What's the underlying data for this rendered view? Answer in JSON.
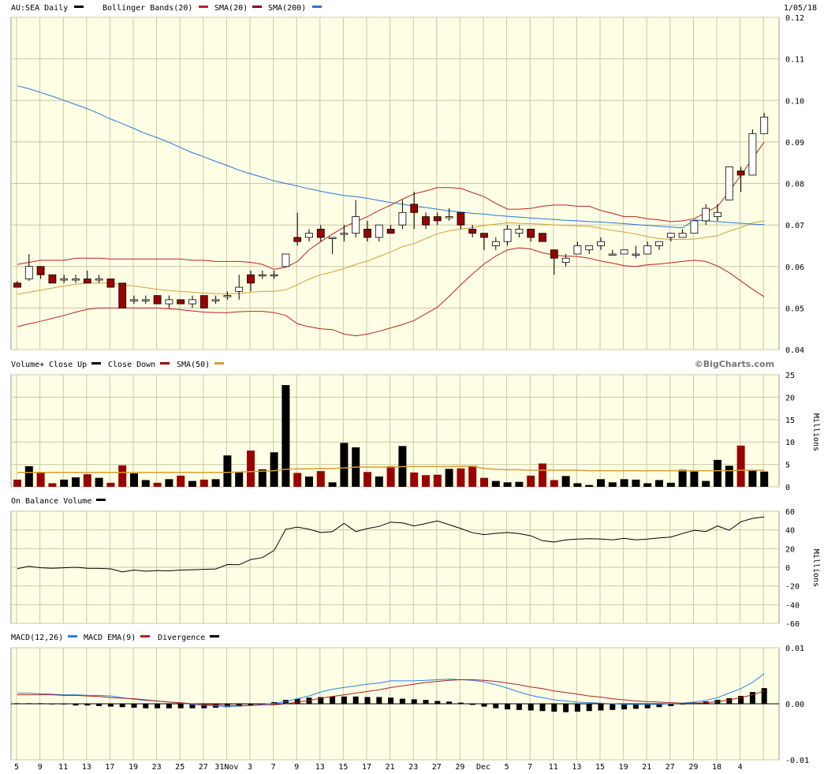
{
  "header": {
    "symbol_title": "AU:SEA Daily",
    "bb_label": "Bollinger Bands(20)",
    "sma20_label": "SMA(20)",
    "sma200_label": "SMA(200)",
    "date": "1/05/18"
  },
  "volume_header": {
    "title": "Volume+",
    "close_up": "Close Up",
    "close_down": "Close Down",
    "sma50": "SMA(50)",
    "credit": "©BigCharts.com",
    "units": "Millions"
  },
  "obv_header": {
    "title": "On Balance Volume",
    "units": "Millions"
  },
  "macd_header": {
    "title": "MACD(12,26)",
    "ema": "MACD EMA(9)",
    "divergence": "Divergence"
  },
  "colors": {
    "panel_bg": "#ffffe6",
    "grid": "#c8c8a0",
    "up": "#000000",
    "down": "#990000",
    "bb": "#bb2222",
    "sma20": "#990000",
    "sma200": "#2a73d8",
    "vol_sma": "#d4a030",
    "macd": "#2a7fe0",
    "macd_ema": "#aa2222"
  },
  "chart_data": [
    {
      "type": "candlestick",
      "title": "AU:SEA Daily",
      "x_tick_labels": [
        "5",
        "9",
        "11",
        "13",
        "17",
        "19",
        "23",
        "25",
        "27",
        "31Nov",
        "3",
        "7",
        "9",
        "13",
        "15",
        "17",
        "21",
        "23",
        "27",
        "29",
        "Dec",
        "5",
        "7",
        "11",
        "13",
        "15",
        "19",
        "21",
        "27",
        "29",
        "18",
        "4"
      ],
      "ylim": [
        0.04,
        0.12
      ],
      "y_ticks": [
        "0.12",
        "0.11",
        "0.10",
        "0.09",
        "0.08",
        "0.07",
        "0.06",
        "0.05",
        "0.04"
      ],
      "ohlc": [
        [
          0.056,
          0.0565,
          0.055,
          0.055
        ],
        [
          0.057,
          0.063,
          0.0565,
          0.06
        ],
        [
          0.06,
          0.06,
          0.057,
          0.058
        ],
        [
          0.058,
          0.058,
          0.056,
          0.056
        ],
        [
          0.057,
          0.058,
          0.056,
          0.057
        ],
        [
          0.057,
          0.058,
          0.056,
          0.057
        ],
        [
          0.057,
          0.059,
          0.056,
          0.056
        ],
        [
          0.057,
          0.058,
          0.056,
          0.057
        ],
        [
          0.057,
          0.057,
          0.055,
          0.055
        ],
        [
          0.056,
          0.056,
          0.05,
          0.05
        ],
        [
          0.052,
          0.053,
          0.051,
          0.052
        ],
        [
          0.052,
          0.053,
          0.051,
          0.052
        ],
        [
          0.053,
          0.053,
          0.051,
          0.051
        ],
        [
          0.051,
          0.053,
          0.05,
          0.052
        ],
        [
          0.052,
          0.052,
          0.051,
          0.051
        ],
        [
          0.051,
          0.053,
          0.05,
          0.052
        ],
        [
          0.053,
          0.053,
          0.05,
          0.05
        ],
        [
          0.052,
          0.053,
          0.051,
          0.052
        ],
        [
          0.053,
          0.054,
          0.052,
          0.053
        ],
        [
          0.054,
          0.058,
          0.052,
          0.055
        ],
        [
          0.058,
          0.059,
          0.054,
          0.056
        ],
        [
          0.058,
          0.059,
          0.057,
          0.058
        ],
        [
          0.058,
          0.059,
          0.057,
          0.058
        ],
        [
          0.06,
          0.063,
          0.06,
          0.063
        ],
        [
          0.067,
          0.073,
          0.065,
          0.066
        ],
        [
          0.067,
          0.069,
          0.066,
          0.068
        ],
        [
          0.069,
          0.07,
          0.066,
          0.067
        ],
        [
          0.067,
          0.067,
          0.063,
          0.067
        ],
        [
          0.068,
          0.07,
          0.066,
          0.068
        ],
        [
          0.068,
          0.076,
          0.067,
          0.072
        ],
        [
          0.069,
          0.071,
          0.066,
          0.067
        ],
        [
          0.067,
          0.07,
          0.066,
          0.07
        ],
        [
          0.069,
          0.07,
          0.068,
          0.068
        ],
        [
          0.07,
          0.076,
          0.069,
          0.073
        ],
        [
          0.075,
          0.078,
          0.069,
          0.073
        ],
        [
          0.072,
          0.073,
          0.069,
          0.07
        ],
        [
          0.072,
          0.073,
          0.07,
          0.071
        ],
        [
          0.072,
          0.074,
          0.071,
          0.072
        ],
        [
          0.073,
          0.073,
          0.069,
          0.07
        ],
        [
          0.069,
          0.07,
          0.067,
          0.068
        ],
        [
          0.068,
          0.068,
          0.064,
          0.067
        ],
        [
          0.065,
          0.067,
          0.064,
          0.066
        ],
        [
          0.066,
          0.07,
          0.065,
          0.069
        ],
        [
          0.068,
          0.07,
          0.067,
          0.069
        ],
        [
          0.069,
          0.069,
          0.066,
          0.067
        ],
        [
          0.068,
          0.068,
          0.066,
          0.066
        ],
        [
          0.064,
          0.064,
          0.058,
          0.062
        ],
        [
          0.061,
          0.063,
          0.06,
          0.062
        ],
        [
          0.063,
          0.066,
          0.063,
          0.065
        ],
        [
          0.064,
          0.065,
          0.063,
          0.065
        ],
        [
          0.065,
          0.067,
          0.064,
          0.066
        ],
        [
          0.063,
          0.064,
          0.063,
          0.063
        ],
        [
          0.063,
          0.064,
          0.063,
          0.064
        ],
        [
          0.063,
          0.065,
          0.062,
          0.063
        ],
        [
          0.063,
          0.066,
          0.063,
          0.065
        ],
        [
          0.065,
          0.066,
          0.064,
          0.066
        ],
        [
          0.067,
          0.068,
          0.066,
          0.068
        ],
        [
          0.067,
          0.069,
          0.067,
          0.068
        ],
        [
          0.068,
          0.071,
          0.068,
          0.071
        ],
        [
          0.071,
          0.075,
          0.07,
          0.074
        ],
        [
          0.072,
          0.075,
          0.071,
          0.073
        ],
        [
          0.076,
          0.084,
          0.076,
          0.084
        ],
        [
          0.083,
          0.084,
          0.078,
          0.082
        ],
        [
          0.082,
          0.093,
          0.082,
          0.092
        ],
        [
          0.092,
          0.097,
          0.092,
          0.096
        ]
      ],
      "bollinger_upper": [
        0.0605,
        0.061,
        0.0615,
        0.0615,
        0.0615,
        0.062,
        0.062,
        0.062,
        0.0618,
        0.0618,
        0.0618,
        0.0618,
        0.0618,
        0.0618,
        0.0618,
        0.0615,
        0.0615,
        0.0612,
        0.0612,
        0.0612,
        0.061,
        0.0605,
        0.0593,
        0.0598,
        0.0612,
        0.064,
        0.066,
        0.0678,
        0.0695,
        0.0708,
        0.072,
        0.0735,
        0.0748,
        0.0762,
        0.0775,
        0.0782,
        0.079,
        0.079,
        0.0788,
        0.0778,
        0.0768,
        0.0752,
        0.0738,
        0.0738,
        0.074,
        0.0745,
        0.0748,
        0.0748,
        0.0745,
        0.0745,
        0.0735,
        0.0728,
        0.072,
        0.072,
        0.0715,
        0.0712,
        0.0708,
        0.071,
        0.0715,
        0.073,
        0.0745,
        0.078,
        0.082,
        0.086,
        0.09
      ],
      "sma20": [
        0.0533,
        0.0538,
        0.0543,
        0.0548,
        0.0553,
        0.0557,
        0.056,
        0.056,
        0.056,
        0.0556,
        0.0553,
        0.0549,
        0.0545,
        0.0542,
        0.054,
        0.0538,
        0.0536,
        0.0535,
        0.0534,
        0.0535,
        0.0538,
        0.054,
        0.054,
        0.0544,
        0.0556,
        0.057,
        0.058,
        0.0587,
        0.0595,
        0.0605,
        0.0613,
        0.0624,
        0.0635,
        0.0648,
        0.0655,
        0.0667,
        0.0679,
        0.0686,
        0.069,
        0.0694,
        0.0699,
        0.0702,
        0.0705,
        0.0704,
        0.0703,
        0.0702,
        0.07,
        0.0699,
        0.0698,
        0.0697,
        0.0692,
        0.0687,
        0.0683,
        0.0678,
        0.0672,
        0.0667,
        0.0665,
        0.0665,
        0.0666,
        0.067,
        0.0674,
        0.0685,
        0.0694,
        0.0705,
        0.071
      ],
      "bollinger_lower": [
        0.0455,
        0.0462,
        0.0468,
        0.0475,
        0.0482,
        0.049,
        0.0497,
        0.05,
        0.05,
        0.05,
        0.05,
        0.05,
        0.05,
        0.0498,
        0.0496,
        0.0493,
        0.049,
        0.0489,
        0.0489,
        0.0491,
        0.0492,
        0.0492,
        0.0489,
        0.0482,
        0.0462,
        0.0455,
        0.045,
        0.0448,
        0.0437,
        0.0433,
        0.0437,
        0.0444,
        0.0452,
        0.046,
        0.047,
        0.0486,
        0.0502,
        0.0528,
        0.0556,
        0.0582,
        0.0606,
        0.0625,
        0.064,
        0.0645,
        0.0642,
        0.0633,
        0.0627,
        0.0625,
        0.0624,
        0.062,
        0.0613,
        0.0608,
        0.0602,
        0.06,
        0.0604,
        0.0606,
        0.0609,
        0.0612,
        0.0615,
        0.0612,
        0.0601,
        0.0585,
        0.0565,
        0.0545,
        0.0527
      ],
      "sma200": [
        0.1035,
        0.1028,
        0.1019,
        0.101,
        0.1,
        0.099,
        0.098,
        0.0968,
        0.0955,
        0.0944,
        0.0932,
        0.092,
        0.091,
        0.0899,
        0.0886,
        0.0874,
        0.0864,
        0.0853,
        0.0843,
        0.0832,
        0.0823,
        0.0815,
        0.0806,
        0.08,
        0.0794,
        0.0787,
        0.0781,
        0.0776,
        0.0771,
        0.0768,
        0.0764,
        0.0759,
        0.0754,
        0.075,
        0.0745,
        0.0742,
        0.0738,
        0.0734,
        0.0731,
        0.0728,
        0.0726,
        0.0723,
        0.0721,
        0.0719,
        0.0717,
        0.0715,
        0.0713,
        0.0711,
        0.071,
        0.0708,
        0.0707,
        0.0705,
        0.0703,
        0.0701,
        0.0699,
        0.0697,
        0.0695,
        0.0693,
        0.0712,
        0.071,
        0.0708,
        0.0706,
        0.0704,
        0.0702,
        0.0701
      ]
    },
    {
      "type": "bar",
      "title": "Volume+",
      "units": "Millions",
      "ylim": [
        0,
        25
      ],
      "y_ticks": [
        "25",
        "20",
        "15",
        "10",
        "5",
        "0"
      ],
      "values": [
        1.6,
        4.6,
        3.1,
        0.8,
        1.6,
        2.1,
        2.8,
        2.0,
        0.9,
        4.8,
        3.0,
        1.5,
        0.9,
        1.7,
        2.5,
        1.3,
        1.6,
        1.7,
        7.0,
        3.3,
        8.1,
        3.9,
        7.7,
        22.7,
        3.1,
        2.3,
        3.5,
        1.0,
        9.8,
        8.8,
        3.3,
        2.3,
        4.6,
        9.1,
        3.2,
        2.6,
        2.7,
        4.0,
        4.1,
        4.7,
        2.0,
        1.3,
        1.0,
        1.1,
        2.5,
        5.2,
        1.5,
        2.4,
        0.8,
        0.4,
        1.7,
        1.0,
        1.7,
        1.6,
        0.8,
        1.5,
        0.9,
        3.8,
        3.4,
        1.3,
        6.0,
        4.7,
        9.2,
        3.6,
        3.4
      ],
      "sma50": [
        3.2,
        3.2,
        3.2,
        3.2,
        3.2,
        3.2,
        3.2,
        3.2,
        3.2,
        3.2,
        3.2,
        3.2,
        3.2,
        3.2,
        3.2,
        3.2,
        3.2,
        3.2,
        3.2,
        3.3,
        3.4,
        3.5,
        3.6,
        3.9,
        4.0,
        4.0,
        4.1,
        4.1,
        4.2,
        4.4,
        4.4,
        4.4,
        4.4,
        4.5,
        4.5,
        4.5,
        4.5,
        4.5,
        4.6,
        4.6,
        4.1,
        3.9,
        3.8,
        3.8,
        3.7,
        3.7,
        3.7,
        3.7,
        3.7,
        3.6,
        3.6,
        3.6,
        3.6,
        3.6,
        3.6,
        3.6,
        3.6,
        3.6,
        3.6,
        3.6,
        3.6,
        3.6,
        3.7,
        3.7,
        3.7
      ]
    },
    {
      "type": "line",
      "title": "On Balance Volume",
      "units": "Millions",
      "ylim": [
        -60,
        60
      ],
      "y_ticks": [
        "60",
        "40",
        "20",
        "0",
        "-20",
        "-40",
        "-60"
      ],
      "values": [
        -1.5,
        1.0,
        -0.5,
        -1.0,
        -0.5,
        0.0,
        -1.0,
        -1.2,
        -1.7,
        -5.0,
        -3.0,
        -4.2,
        -3.5,
        -3.8,
        -3.0,
        -2.6,
        -2.2,
        -1.8,
        3.0,
        2.8,
        8.3,
        10.4,
        18.0,
        40.7,
        43.0,
        40.7,
        37.2,
        38.2,
        47.0,
        38.2,
        41.5,
        43.8,
        48.4,
        47.5,
        44.3,
        46.9,
        49.6,
        45.6,
        41.5,
        37.0,
        35.0,
        36.3,
        37.3,
        36.2,
        33.7,
        28.5,
        27.0,
        29.4,
        30.2,
        30.6,
        30.3,
        29.3,
        31.0,
        29.4,
        30.2,
        31.5,
        32.4,
        36.2,
        39.6,
        38.3,
        44.3,
        39.6,
        48.8,
        52.4,
        54.0
      ]
    },
    {
      "type": "line",
      "title": "MACD(12,26)",
      "ylim": [
        -0.01,
        0.01
      ],
      "y_ticks": [
        "0.01",
        "0.00",
        "-0.01"
      ],
      "series": [
        {
          "name": "MACD(12,26)",
          "values": [
            0.0019,
            0.0019,
            0.0018,
            0.0017,
            0.0016,
            0.0016,
            0.0015,
            0.0015,
            0.0014,
            0.0011,
            0.0008,
            0.0006,
            0.0005,
            0.0003,
            0.0001,
            -0.0001,
            -0.0003,
            -0.0004,
            -0.0005,
            -0.0004,
            -0.0003,
            -0.0001,
            0.0001,
            0.0004,
            0.0009,
            0.0014,
            0.0021,
            0.0026,
            0.0029,
            0.0032,
            0.0035,
            0.0037,
            0.0041,
            0.0041,
            0.0041,
            0.0042,
            0.0043,
            0.0044,
            0.0043,
            0.0042,
            0.0039,
            0.0034,
            0.0028,
            0.0021,
            0.0015,
            0.0011,
            0.0007,
            0.0005,
            0.0003,
            0.0002,
            0.0001,
            0.0,
            -0.0001,
            -0.0001,
            -0.0001,
            -0.0001,
            0.0,
            0.0001,
            0.0003,
            0.0006,
            0.0011,
            0.0019,
            0.0027,
            0.0038,
            0.0054
          ]
        },
        {
          "name": "MACD EMA(9)",
          "values": [
            0.0016,
            0.0016,
            0.0016,
            0.0016,
            0.0015,
            0.0015,
            0.0014,
            0.0013,
            0.0011,
            0.001,
            0.0009,
            0.0007,
            0.0005,
            0.0003,
            0.0002,
            0.0,
            -0.0001,
            -0.0002,
            -0.0003,
            -0.0003,
            -0.0003,
            -0.0002,
            -0.0002,
            0.0,
            0.0003,
            0.0006,
            0.001,
            0.0013,
            0.0016,
            0.0019,
            0.0022,
            0.0025,
            0.0029,
            0.0032,
            0.0035,
            0.0038,
            0.004,
            0.0042,
            0.0043,
            0.0043,
            0.0042,
            0.004,
            0.0037,
            0.0034,
            0.003,
            0.0027,
            0.0023,
            0.002,
            0.0017,
            0.0014,
            0.0012,
            0.0009,
            0.0007,
            0.0005,
            0.0004,
            0.0003,
            0.0002,
            0.0001,
            0.0001,
            0.0002,
            0.0004,
            0.0007,
            0.0011,
            0.0016,
            0.0023
          ]
        },
        {
          "name": "Divergence",
          "values": [
            0.0001,
            0.0001,
            0.0001,
            0.0,
            0.0,
            -0.0003,
            -0.0003,
            -0.0004,
            -0.0005,
            -0.0006,
            -0.0007,
            -0.0008,
            -0.0008,
            -0.0008,
            -0.0008,
            -0.0008,
            -0.0008,
            -0.0007,
            -0.0006,
            -0.0005,
            -0.0003,
            -0.0001,
            0.0003,
            0.0007,
            0.0009,
            0.0011,
            0.0012,
            0.0013,
            0.0013,
            0.0013,
            0.0012,
            0.0012,
            0.0011,
            0.0009,
            0.0008,
            0.0007,
            0.0005,
            0.0004,
            0.0002,
            -0.0002,
            -0.0005,
            -0.0008,
            -0.001,
            -0.0011,
            -0.0012,
            -0.0013,
            -0.0014,
            -0.0015,
            -0.0014,
            -0.0013,
            -0.0012,
            -0.0011,
            -0.001,
            -0.0009,
            -0.0008,
            -0.0006,
            -0.0004,
            -0.0001,
            0.0002,
            0.0004,
            0.0007,
            0.001,
            0.0014,
            0.0021,
            0.0028
          ]
        }
      ]
    }
  ]
}
